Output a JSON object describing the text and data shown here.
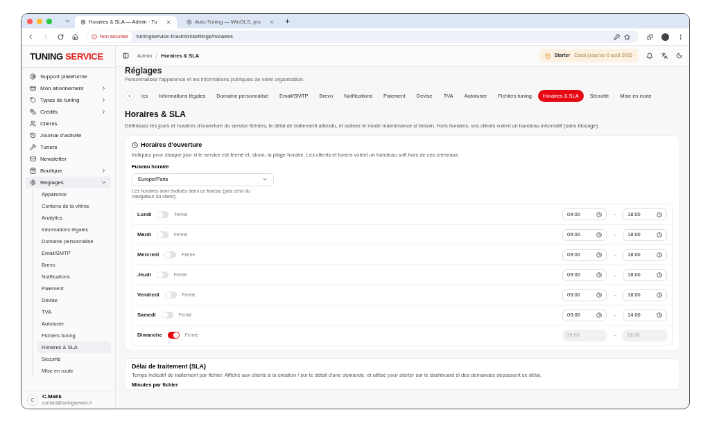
{
  "browser": {
    "tabs": [
      {
        "title": "Horaires & SLA — Admin · Tu",
        "selected": true
      },
      {
        "title": "Auto-Tuning — WinOLS, pro",
        "selected": false
      }
    ],
    "security": "Non sécurisé",
    "url": "tuningservice.fr/admin/settings/horaires"
  },
  "brand": {
    "first": "TUNING",
    "second": "SERVICE"
  },
  "sidebar": {
    "items": [
      {
        "label": "Support plateforme",
        "has_children": false,
        "expanded": false
      },
      {
        "label": "Mon abonnement",
        "has_children": true,
        "expanded": false
      },
      {
        "label": "Types de tuning",
        "has_children": true,
        "expanded": false
      },
      {
        "label": "Crédits",
        "has_children": true,
        "expanded": false
      },
      {
        "label": "Clients",
        "has_children": false,
        "expanded": false
      },
      {
        "label": "Journal d'activité",
        "has_children": false,
        "expanded": false
      },
      {
        "label": "Tuners",
        "has_children": false,
        "expanded": false
      },
      {
        "label": "Newsletter",
        "has_children": false,
        "expanded": false
      },
      {
        "label": "Boutique",
        "has_children": true,
        "expanded": false
      },
      {
        "label": "Réglages",
        "has_children": true,
        "expanded": true,
        "children": [
          {
            "label": "Apparence",
            "selected": false
          },
          {
            "label": "Contenu de la vitrine",
            "selected": false
          },
          {
            "label": "Analytics",
            "selected": false
          },
          {
            "label": "Informations légales",
            "selected": false
          },
          {
            "label": "Domaine personnalisé",
            "selected": false
          },
          {
            "label": "Email/SMTP",
            "selected": false
          },
          {
            "label": "Brevo",
            "selected": false
          },
          {
            "label": "Notifications",
            "selected": false
          },
          {
            "label": "Paiement",
            "selected": false
          },
          {
            "label": "Devise",
            "selected": false
          },
          {
            "label": "TVA",
            "selected": false
          },
          {
            "label": "Autotuner",
            "selected": false
          },
          {
            "label": "Fichiers tuning",
            "selected": false
          },
          {
            "label": "Horaires & SLA",
            "selected": true
          },
          {
            "label": "Sécurité",
            "selected": false
          },
          {
            "label": "Mise en route",
            "selected": false
          }
        ]
      }
    ],
    "user": {
      "initial": "C",
      "name": "C.Malik",
      "email": "contact@tuningservice.fr"
    }
  },
  "header": {
    "breadcrumb": [
      "Admin",
      "Horaires & SLA"
    ],
    "plan": {
      "name": "Starter",
      "note": "Essai jusqu'au 6 août 2026"
    }
  },
  "page": {
    "title": "Réglages",
    "subtitle": "Personnalisez l'apparence et les informations publiques de votre organisation."
  },
  "settings_tabs": [
    {
      "label": "ics",
      "selected": false
    },
    {
      "label": "Informations légales",
      "selected": false
    },
    {
      "label": "Domaine personnalisé",
      "selected": false
    },
    {
      "label": "Email/SMTP",
      "selected": false
    },
    {
      "label": "Brevo",
      "selected": false
    },
    {
      "label": "Notifications",
      "selected": false
    },
    {
      "label": "Paiement",
      "selected": false
    },
    {
      "label": "Devise",
      "selected": false
    },
    {
      "label": "TVA",
      "selected": false
    },
    {
      "label": "Autotuner",
      "selected": false
    },
    {
      "label": "Fichiers tuning",
      "selected": false
    },
    {
      "label": "Horaires & SLA",
      "selected": true
    },
    {
      "label": "Sécurité",
      "selected": false
    },
    {
      "label": "Mise en route",
      "selected": false
    }
  ],
  "section": {
    "title": "Horaires & SLA",
    "description": "Définissez les jours et horaires d'ouverture du service fichiers, le délai de traitement attendu, et activez le mode maintenance si besoin. Hors horaires, vos clients voient un bandeau informatif (sans blocage)."
  },
  "hours_card": {
    "title": "Horaires d'ouverture",
    "description": "Indiquez pour chaque jour si le service est fermé et, sinon, la plage horaire. Les clients et tuners voient un bandeau soft hors de ces créneaux.",
    "timezone_label": "Fuseau horaire",
    "timezone": "Europe/Paris",
    "timezone_help": "Les horaires sont évalués dans ce fuseau (pas celui du navigateur du client).",
    "days": [
      {
        "day": "Lundi",
        "closed_label": "Fermé",
        "closed": false,
        "open": "09:00",
        "close": "18:00"
      },
      {
        "day": "Mardi",
        "closed_label": "Fermé",
        "closed": false,
        "open": "09:00",
        "close": "18:00"
      },
      {
        "day": "Mercredi",
        "closed_label": "Fermé",
        "closed": false,
        "open": "09:00",
        "close": "18:00"
      },
      {
        "day": "Jeudi",
        "closed_label": "Fermé",
        "closed": false,
        "open": "09:00",
        "close": "18:00"
      },
      {
        "day": "Vendredi",
        "closed_label": "Fermé",
        "closed": false,
        "open": "09:00",
        "close": "18:00"
      },
      {
        "day": "Samedi",
        "closed_label": "Fermé",
        "closed": false,
        "open": "09:00",
        "close": "14:00"
      },
      {
        "day": "Dimanche",
        "closed_label": "Fermé",
        "closed": true,
        "open": "09:00",
        "close": "18:00"
      }
    ],
    "arrow": "→"
  },
  "sla_card": {
    "title": "Délai de traitement (SLA)",
    "description": "Temps indicatif de traitement par fichier. Affiché aux clients à la création / sur le détail d'une demande, et utilisé pour alerter sur le dashboard si des demandes dépassent ce délai.",
    "field_label": "Minutes par fichier"
  }
}
